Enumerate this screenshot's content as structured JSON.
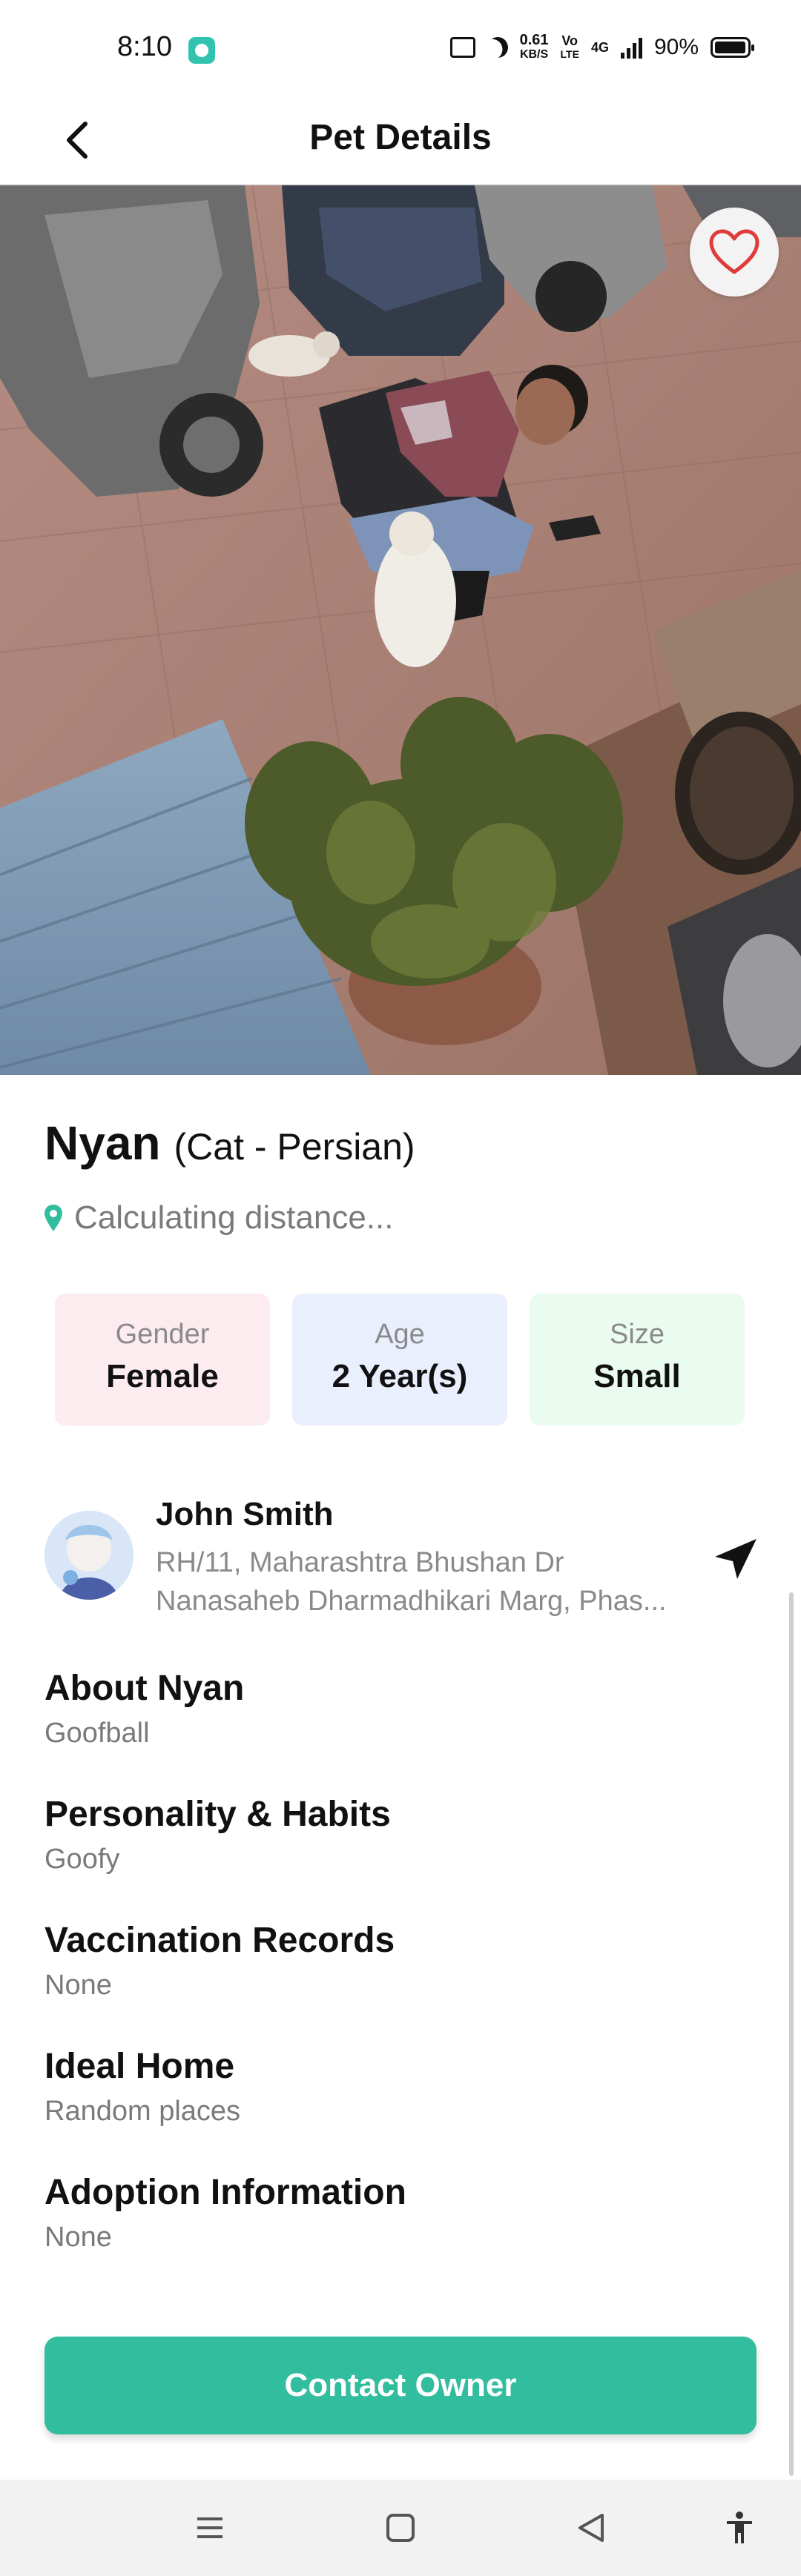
{
  "status_bar": {
    "time": "8:10",
    "net_speed_value": "0.61",
    "net_speed_unit": "KB/S",
    "volte_top": "Vo",
    "volte_bottom": "LTE",
    "network": "4G",
    "battery": "90%"
  },
  "app_bar": {
    "title": "Pet Details",
    "back_icon": "back-arrow-icon"
  },
  "hero": {
    "favorite_icon": "heart-outline-icon"
  },
  "pet": {
    "name": "Nyan",
    "breed": "(Cat - Persian)",
    "distance": "Calculating distance..."
  },
  "stats": [
    {
      "label": "Gender",
      "value": "Female",
      "color": "#fdecef"
    },
    {
      "label": "Age",
      "value": "2 Year(s)",
      "color": "#e9effd"
    },
    {
      "label": "Size",
      "value": "Small",
      "color": "#eafbf0"
    }
  ],
  "owner": {
    "name": "John Smith",
    "address_line1": "RH/11, Maharashtra Bhushan Dr",
    "address_line2": "Nanasaheb Dharmadhikari Marg, Phas..."
  },
  "sections": [
    {
      "heading": "About Nyan",
      "text": "Goofball"
    },
    {
      "heading": "Personality & Habits",
      "text": "Goofy"
    },
    {
      "heading": "Vaccination Records",
      "text": "None"
    },
    {
      "heading": "Ideal Home",
      "text": "Random places"
    },
    {
      "heading": "Adoption Information",
      "text": "None"
    }
  ],
  "contact_button": {
    "label": "Contact Owner",
    "color": "#33bd9f"
  },
  "nav_bar": [
    "menu-icon",
    "home-square-icon",
    "back-triangle-icon",
    "accessibility-icon"
  ]
}
